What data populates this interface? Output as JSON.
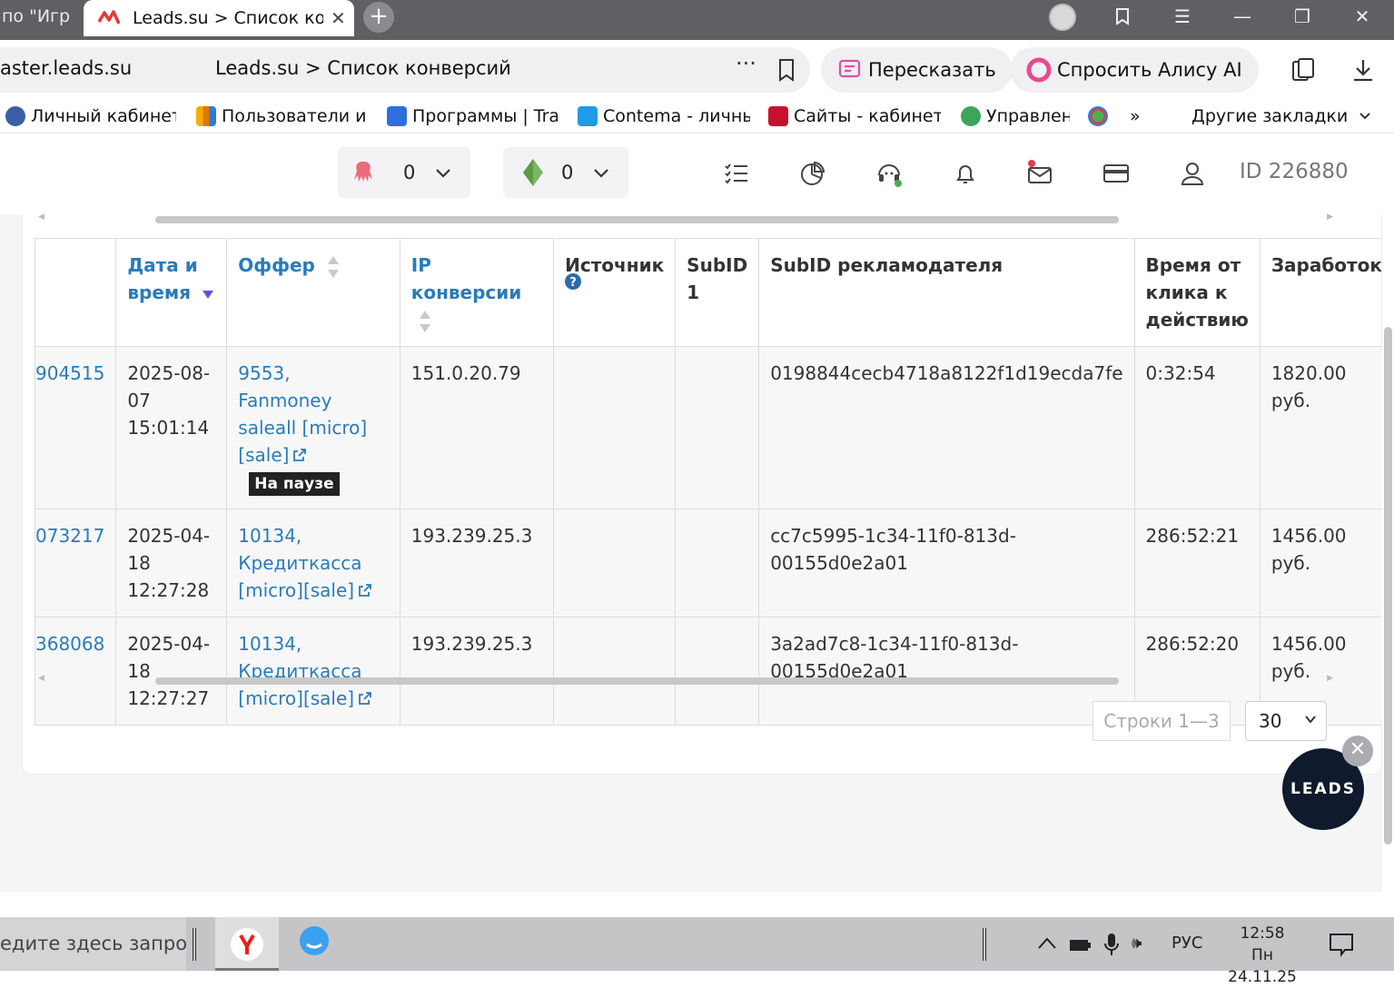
{
  "browser": {
    "prev_tab_title": "по \"Игр",
    "active_tab_title": "Leads.su > Список конверсий",
    "url_domain": "aster.leads.su",
    "url_title": "Leads.su > Список конверсий",
    "retell_label": "Пересказать",
    "ask_alice_label": "Спросить Алису AI"
  },
  "bookmarks": [
    {
      "label": "Личный кабинет",
      "color": "#3a5fa8"
    },
    {
      "label": "Пользователи и р",
      "color": "#2e7bd6"
    },
    {
      "label": "Программы | Trav",
      "color": "#2d6fe0"
    },
    {
      "label": "Contema - личный",
      "color": "#1e9be9"
    },
    {
      "label": "Сайты - кабинет в",
      "color": "#c8102e"
    },
    {
      "label": "Управлен",
      "color": "#3ba55c"
    }
  ],
  "bookmarks_more_label": "»",
  "bookmarks_other_label": "Другие закладки",
  "header": {
    "balance_red": "0",
    "balance_green": "0",
    "user_id": "ID 226880"
  },
  "table": {
    "columns": [
      "Дата и время",
      "Оффер",
      "IP конверсии",
      "Источник",
      "SubID 1",
      "SubID рекламодателя",
      "Время от клика к действию",
      "Заработок"
    ],
    "rows": [
      {
        "id": "904515",
        "date": "2025-08-07 15:01:14",
        "offer": "9553, Fanmoney saleall [micro] [sale]",
        "badge": "На паузе",
        "ip": "151.0.20.79",
        "source": "",
        "subid1": "",
        "adv_subid": "0198844cecb4718a8122f1d19ecda7fe",
        "time": "0:32:54",
        "earn": "1820.00 руб."
      },
      {
        "id": "073217",
        "date": "2025-04-18 12:27:28",
        "offer": "10134, Кредиткасса [micro][sale]",
        "badge": "",
        "ip": "193.239.25.3",
        "source": "",
        "subid1": "",
        "adv_subid": "cc7c5995-1c34-11f0-813d-00155d0e2a01",
        "time": "286:52:21",
        "earn": "1456.00 руб."
      },
      {
        "id": "368068",
        "date": "2025-04-18 12:27:27",
        "offer": "10134, Кредиткасса [micro][sale]",
        "badge": "",
        "ip": "193.239.25.3",
        "source": "",
        "subid1": "",
        "adv_subid": "3a2ad7c8-1c34-11f0-813d-00155d0e2a01",
        "time": "286:52:20",
        "earn": "1456.00 руб."
      }
    ]
  },
  "pagination": {
    "rows_label": "Строки 1—3",
    "per_page": "30"
  },
  "leads_widget_label": "LEADS",
  "taskbar": {
    "search_placeholder": "едите здесь запрос",
    "lang": "РУС",
    "time": "12:58",
    "date": "Пн 24.11.25"
  },
  "colors": {
    "link": "#2b7bb9",
    "badge_bg": "#222222",
    "fab_bg": "#0f1a2c"
  }
}
